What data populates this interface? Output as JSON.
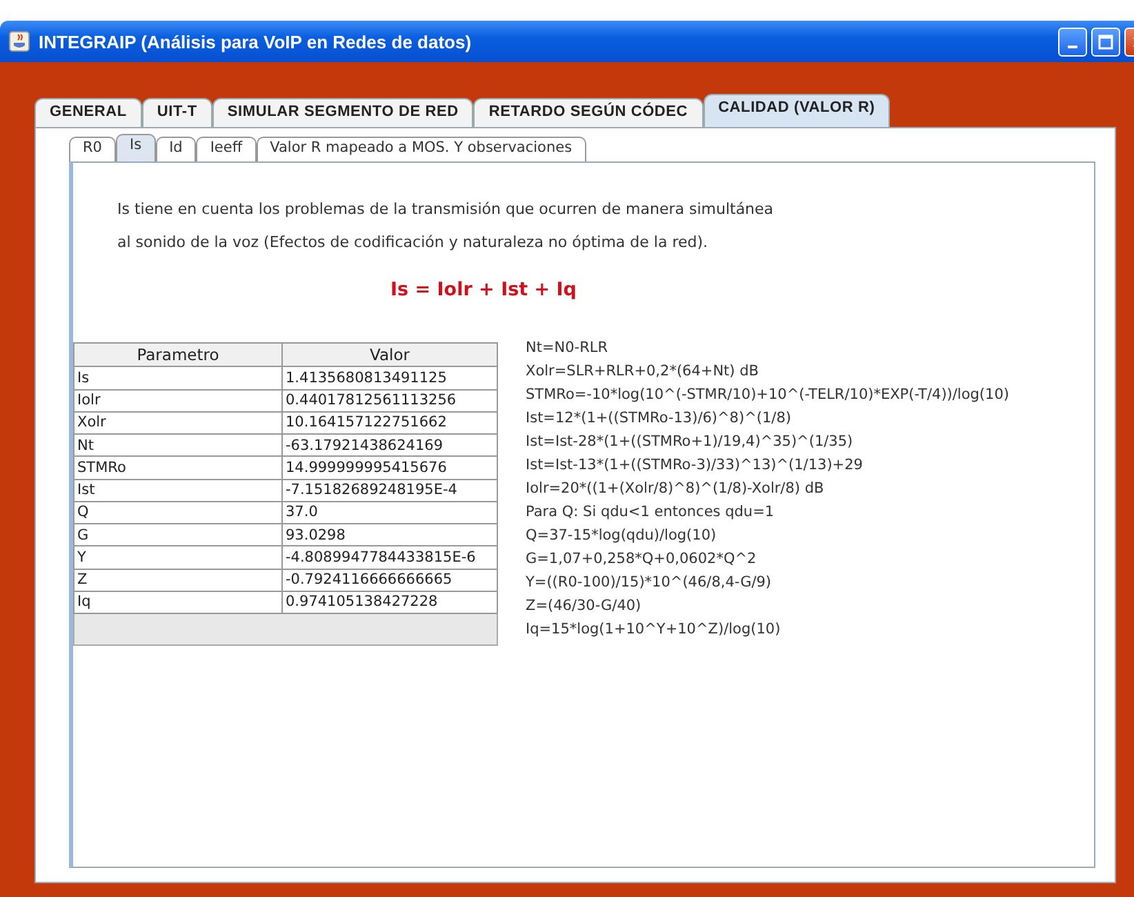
{
  "window": {
    "title": "INTEGRAIP (Análisis para VoIP en Redes de datos)"
  },
  "tabs": [
    {
      "label": "GENERAL",
      "selected": false
    },
    {
      "label": "UIT-T",
      "selected": false
    },
    {
      "label": "SIMULAR SEGMENTO DE RED",
      "selected": false
    },
    {
      "label": "RETARDO SEGÚN CÓDEC",
      "selected": false
    },
    {
      "label": "CALIDAD (VALOR R)",
      "selected": true
    }
  ],
  "subtabs": [
    {
      "label": "R0",
      "selected": false
    },
    {
      "label": "Is",
      "selected": true
    },
    {
      "label": "Id",
      "selected": false
    },
    {
      "label": "Ieeff",
      "selected": false
    },
    {
      "label": "Valor R mapeado a MOS. Y observaciones",
      "selected": false
    }
  ],
  "description": [
    "Is tiene en cuenta los problemas de la transmisión que ocurren de manera simultánea",
    "al sonido de la voz (Efectos de codificación y naturaleza no óptima de la red)."
  ],
  "equation": "Is = Iolr + Ist + Iq",
  "table": {
    "columns": [
      "Parametro",
      "Valor"
    ],
    "rows": [
      [
        "Is",
        "1.4135680813491125"
      ],
      [
        "Iolr",
        "0.44017812561113256"
      ],
      [
        "Xolr",
        "10.164157122751662"
      ],
      [
        "Nt",
        "-63.17921438624169"
      ],
      [
        "STMRo",
        "14.999999995415676"
      ],
      [
        "Ist",
        "-7.15182689248195E-4"
      ],
      [
        "Q",
        "37.0"
      ],
      [
        "G",
        "93.0298"
      ],
      [
        "Y",
        "-4.8089947784433815E-6"
      ],
      [
        "Z",
        "-0.7924116666666665"
      ],
      [
        "Iq",
        "0.974105138427228"
      ]
    ]
  },
  "formulas": [
    "Nt=N0-RLR",
    "Xolr=SLR+RLR+0,2*(64+Nt)  dB",
    "STMRo=-10*log(10^(-STMR/10)+10^(-TELR/10)*EXP(-T/4))/log(10)",
    "Ist=12*(1+((STMRo-13)/6)^8)^(1/8)",
    "Ist=Ist-28*(1+((STMRo+1)/19,4)^35)^(1/35)",
    "Ist=Ist-13*(1+((STMRo-3)/33)^13)^(1/13)+29",
    "Iolr=20*((1+(Xolr/8)^8)^(1/8)-Xolr/8)   dB",
    "Para Q: Si qdu<1 entonces qdu=1",
    "Q=37-15*log(qdu)/log(10)",
    "G=1,07+0,258*Q+0,0602*Q^2",
    "Y=((R0-100)/15)*10^(46/8,4-G/9)",
    "Z=(46/30-G/40)",
    "Iq=15*log(1+10^Y+10^Z)/log(10)"
  ]
}
